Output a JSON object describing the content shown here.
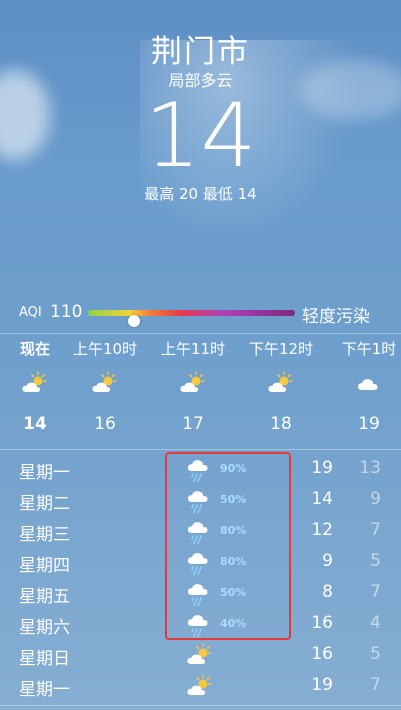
{
  "location": {
    "city": "荆门市",
    "condition": "局部多云",
    "temperature": "14",
    "high_low": "最高 20  最低 14"
  },
  "aqi": {
    "label": "AQI",
    "value": "110",
    "level": 0.22,
    "description": "轻度污染"
  },
  "hourly": [
    {
      "time": "现在",
      "icon": "partly-sunny-icon",
      "temp": "14"
    },
    {
      "time": "上午10时",
      "icon": "partly-sunny-icon",
      "temp": "16"
    },
    {
      "time": "上午11时",
      "icon": "partly-sunny-icon",
      "temp": "17"
    },
    {
      "time": "下午12时",
      "icon": "partly-sunny-icon",
      "temp": "18"
    },
    {
      "time": "下午1时",
      "icon": "cloud-icon",
      "temp": "19"
    }
  ],
  "daily": [
    {
      "day": "星期一",
      "icon": "rain-icon",
      "prob": "90%",
      "high": "19",
      "low": "13"
    },
    {
      "day": "星期二",
      "icon": "rain-icon",
      "prob": "50%",
      "high": "14",
      "low": "9"
    },
    {
      "day": "星期三",
      "icon": "rain-icon",
      "prob": "80%",
      "high": "12",
      "low": "7"
    },
    {
      "day": "星期四",
      "icon": "rain-icon",
      "prob": "80%",
      "high": "9",
      "low": "5"
    },
    {
      "day": "星期五",
      "icon": "rain-icon",
      "prob": "50%",
      "high": "8",
      "low": "7"
    },
    {
      "day": "星期六",
      "icon": "rain-icon",
      "prob": "40%",
      "high": "16",
      "low": "4"
    },
    {
      "day": "星期日",
      "icon": "partly-sunny-icon",
      "prob": "",
      "high": "16",
      "low": "5"
    },
    {
      "day": "星期一",
      "icon": "partly-sunny-icon",
      "prob": "",
      "high": "19",
      "low": "7"
    }
  ],
  "colors": {
    "highlight": "#e63a3a",
    "precip": "#a9dcff"
  }
}
